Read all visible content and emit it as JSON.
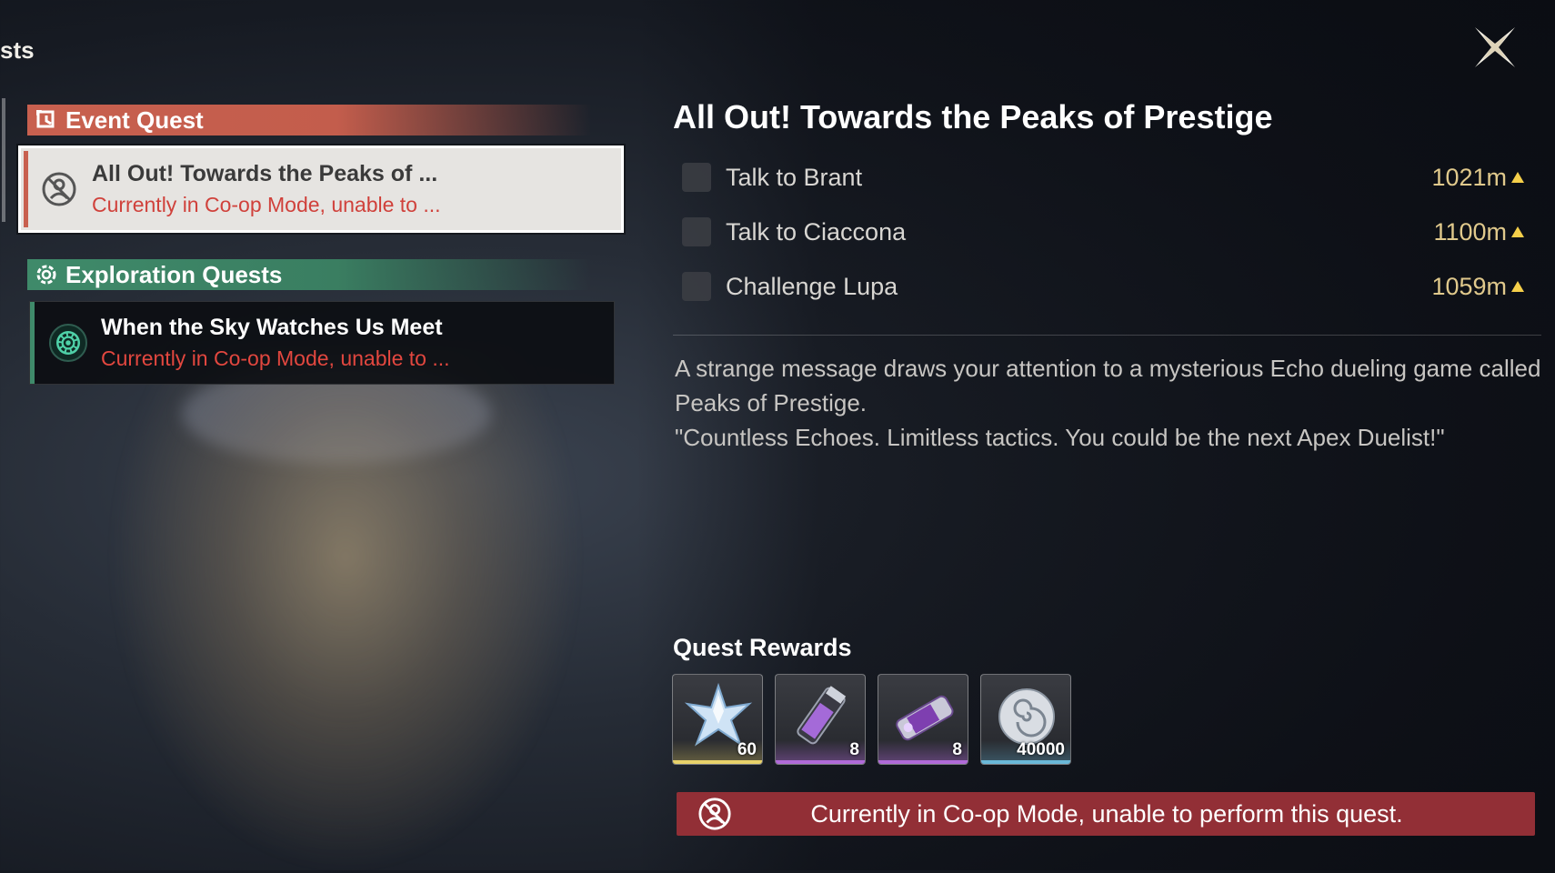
{
  "header": {
    "breadcrumb": "sts"
  },
  "quest_list": {
    "event_category": {
      "label": "Event Quest",
      "icon": "event-quest-icon",
      "color": "#c8604f"
    },
    "event_quest": {
      "title": "All Out! Towards the Peaks of ...",
      "status": "Currently in Co-op Mode, unable to ...",
      "icon": "co-op-blocked-icon"
    },
    "exploration_category": {
      "label": "Exploration Quests",
      "icon": "exploration-quest-icon",
      "color": "#3f8a6a"
    },
    "exploration_quest": {
      "title": "When the Sky Watches Us Meet",
      "status": "Currently in Co-op Mode, unable to ...",
      "icon": "exploration-gear-icon"
    }
  },
  "detail": {
    "title": "All Out! Towards the Peaks of Prestige",
    "tasks": [
      {
        "name": "Talk to Brant",
        "distance": "1021m"
      },
      {
        "name": "Talk to Ciaccona",
        "distance": "1100m"
      },
      {
        "name": "Challenge Lupa",
        "distance": "1059m"
      }
    ],
    "description": [
      "A strange message draws your attention to a mysterious Echo dueling game called Peaks of Prestige.",
      "\"Countless Echoes. Limitless tactics. You could be the next Apex Duelist!\""
    ]
  },
  "rewards": {
    "title": "Quest Rewards",
    "items": [
      {
        "icon": "astrite-star-icon",
        "quantity": "60",
        "rarity_color": "#e8d26a"
      },
      {
        "icon": "energy-vial-icon",
        "quantity": "8",
        "rarity_color": "#b06ad8"
      },
      {
        "icon": "purple-cylinder-icon",
        "quantity": "8",
        "rarity_color": "#b06ad8"
      },
      {
        "icon": "shell-credit-icon",
        "quantity": "40000",
        "rarity_color": "#6ab8d8"
      }
    ]
  },
  "banner": {
    "text": "Currently in Co-op Mode, unable to perform this quest.",
    "color": "#922f36"
  }
}
